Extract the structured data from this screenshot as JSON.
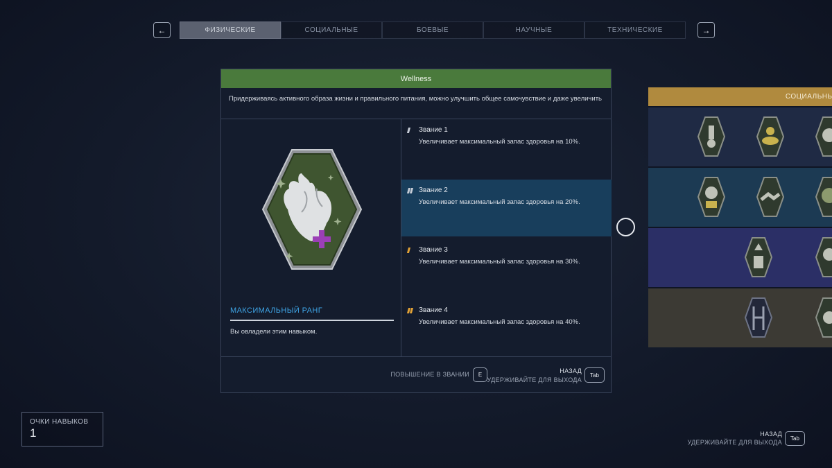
{
  "nav": {
    "prev_glyph": "←",
    "next_glyph": "→",
    "tabs": [
      {
        "label": "ФИЗИЧЕСКИЕ",
        "active": true
      },
      {
        "label": "СОЦИАЛЬНЫЕ",
        "active": false
      },
      {
        "label": "БОЕВЫЕ",
        "active": false
      },
      {
        "label": "НАУЧНЫЕ",
        "active": false
      },
      {
        "label": "ТЕХНИЧЕСКИЕ",
        "active": false
      }
    ]
  },
  "skill": {
    "name": "Wellness",
    "description": "Придерживаясь активного образа жизни и правильного питания, можно улучшить общее самочувствие и даже увеличить",
    "badge_icon": "heart-plus-icon",
    "max_rank_label": "МАКСИМАЛЬНЫЙ РАНГ",
    "status_text": "Вы овладели этим навыком.",
    "ranks": [
      {
        "title": "Звание 1",
        "desc": "Увеличивает максимальный запас здоровья на 10%.",
        "pips": 1,
        "pip_color": "#c6ccd6",
        "selected": false
      },
      {
        "title": "Звание 2",
        "desc": "Увеличивает максимальный запас здоровья на 20%.",
        "pips": 2,
        "pip_color": "#c6ccd6",
        "selected": true
      },
      {
        "title": "Звание 3",
        "desc": "Увеличивает максимальный запас здоровья на 30%.",
        "pips": 1,
        "pip_color": "#e2a236",
        "selected": false
      },
      {
        "title": "Звание 4",
        "desc": "Увеличивает максимальный запас здоровья на 40%.",
        "pips": 2,
        "pip_color": "#e2a236",
        "selected": false
      }
    ]
  },
  "footer": {
    "rank_up_label": "ПОВЫШЕНИЕ В ЗВАНИИ",
    "rank_up_key": "E",
    "back_label": "НАЗАД",
    "hold_label": "УДЕРЖИВАЙТЕ ДЛЯ ВЫХОДА",
    "back_key": "Tab"
  },
  "tree": {
    "header": "СОЦИАЛЬНЫЕ",
    "accent": "#b08a3e"
  },
  "points": {
    "label": "ОЧКИ НАВЫКОВ",
    "value": "1"
  },
  "global_footer": {
    "back_label": "НАЗАД",
    "hold_label": "УДЕРЖИВАЙТЕ ДЛЯ ВЫХОДА",
    "back_key": "Tab"
  },
  "colors": {
    "header_green": "#4a7a3c",
    "selected_blue": "#183e5c",
    "max_rank_blue": "#3fa6e8",
    "rank_gold": "#e2a236"
  }
}
